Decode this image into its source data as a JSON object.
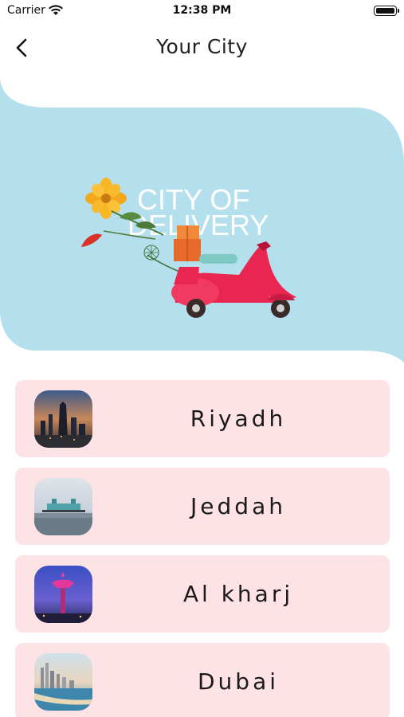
{
  "status_bar": {
    "carrier": "Carrier",
    "time": "12:38 PM"
  },
  "nav": {
    "title": "Your City",
    "back_icon": "chevron-left-icon"
  },
  "banner": {
    "text_line1": "CITY OF",
    "text_line2": "DELIVERY",
    "background_color": "#b3e0ec"
  },
  "cities": [
    {
      "name": "Riyadh",
      "thumb": "riyadh-skyline-image"
    },
    {
      "name": "Jeddah",
      "thumb": "jeddah-waterfront-image"
    },
    {
      "name": "Al kharj",
      "thumb": "al-kharj-tower-image"
    },
    {
      "name": "Dubai",
      "thumb": "dubai-marina-image"
    }
  ],
  "colors": {
    "card_background": "#fde2e6",
    "banner_background": "#b3e0ec",
    "scooter_red": "#e8264f"
  }
}
